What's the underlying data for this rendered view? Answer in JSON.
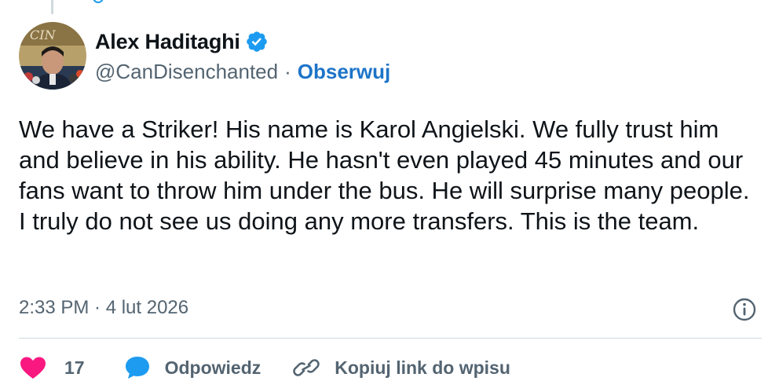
{
  "tweet": {
    "author": {
      "display_name": "Alex Haditaghi",
      "handle": "@CanDisenchanted",
      "separator": "·",
      "follow_label": "Obserwuj",
      "verified": true,
      "avatar_caption": "CIN"
    },
    "text": "We have a Striker! His name is Karol Angielski. We fully trust him and believe in his ability. He hasn't even played 45 minutes and our fans want to throw him under the bus. He will surprise many people. I truly do not see us doing any more transfers. This is the team.",
    "timestamp": "2:33 PM · 4 lut 2026",
    "actions": {
      "like_count": "17",
      "reply_label": "Odpowiedz",
      "copy_link_label": "Kopiuj link do wpisu"
    }
  },
  "icons": {
    "verified": "verified-badge-icon",
    "info": "info-icon",
    "like": "heart-icon",
    "reply": "reply-bubble-icon",
    "copy_link": "link-icon"
  },
  "colors": {
    "accent_blue": "#1d9bf0",
    "follow_blue": "#1d74c8",
    "like_red": "#f91880",
    "secondary_text": "#536471",
    "primary_text": "#0f1419",
    "divider": "#cfd9de"
  }
}
